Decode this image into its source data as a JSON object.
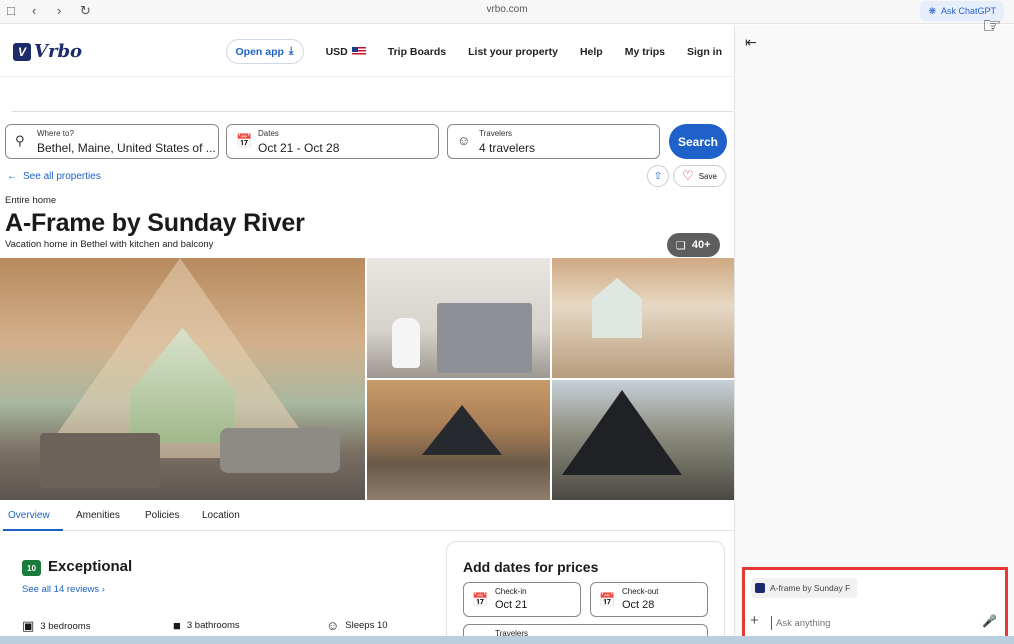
{
  "browser": {
    "url": "vrbo.com",
    "ask_chatgpt": "Ask ChatGPT"
  },
  "header": {
    "logo_text": "Vrbo",
    "open_app": "Open app",
    "currency": "USD",
    "trip_boards": "Trip Boards",
    "list_property": "List your property",
    "help": "Help",
    "my_trips": "My trips",
    "sign_in": "Sign in"
  },
  "search": {
    "where_label": "Where to?",
    "where_value": "Bethel, Maine, United States of ...",
    "dates_label": "Dates",
    "dates_value": "Oct 21 - Oct 28",
    "travelers_label": "Travelers",
    "travelers_value": "4 travelers",
    "button": "Search"
  },
  "listing": {
    "see_all": "See all properties",
    "save": "Save",
    "type": "Entire home",
    "title": "A-Frame by Sunday River",
    "subtitle": "Vacation home in Bethel with kitchen and balcony",
    "photo_count": "40+"
  },
  "tabs": [
    "Overview",
    "Amenities",
    "Policies",
    "Location"
  ],
  "rating": {
    "score": "10",
    "word": "Exceptional",
    "reviews_link": "See all 14 reviews"
  },
  "facts": {
    "bedrooms": "3 bedrooms",
    "bathrooms": "3 bathrooms",
    "sleeps": "Sleeps 10"
  },
  "pricing": {
    "title": "Add dates for prices",
    "checkin_label": "Check-in",
    "checkin_value": "Oct 21",
    "checkout_label": "Check-out",
    "checkout_value": "Oct 28",
    "travelers_label": "Travelers"
  },
  "chat_panel": {
    "chip_text": "A-frame by Sunday F",
    "placeholder": "Ask anything"
  },
  "colors": {
    "accent": "#1e62c9",
    "score_green": "#1c7a3d",
    "highlight_red": "#e53935"
  }
}
